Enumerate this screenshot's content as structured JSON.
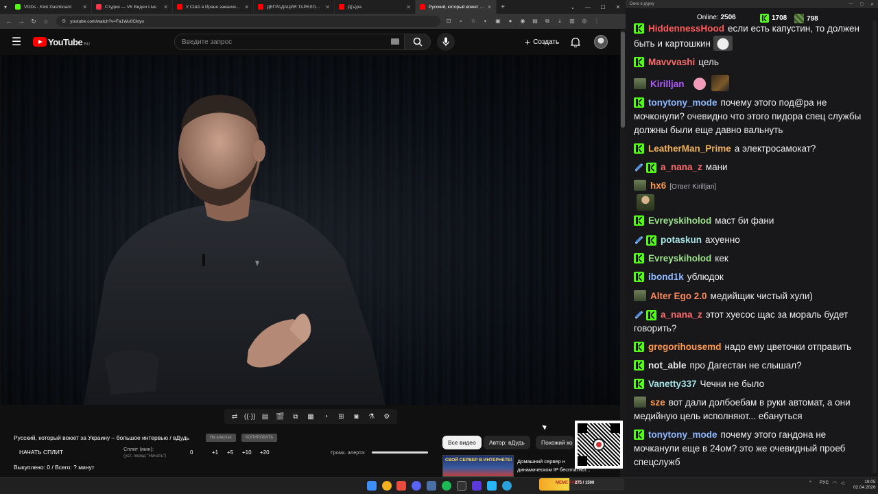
{
  "browser": {
    "tabs": [
      {
        "label": "VODs - Kick Dashboard",
        "color": "#53fc18",
        "active": false
      },
      {
        "label": "Студия — VK Видео Live",
        "color": "#ff3347",
        "active": false
      },
      {
        "label": "У США в Иране заканчиваются",
        "color": "#ff0000",
        "active": false
      },
      {
        "label": "ДЕГРАДАЦИЯ ТАРЕЛОЧНИЦ",
        "color": "#ff0000",
        "active": false
      },
      {
        "label": "Д(ъ)ра",
        "color": "#ff0000",
        "active": false
      },
      {
        "label": "Русский, который воюет за Ук",
        "color": "#ff0000",
        "active": true
      }
    ],
    "url": "youtube.com/watch?v=Fa1Wu0Cktyo"
  },
  "youtube": {
    "logo_text": "YouTube",
    "logo_region": "RU",
    "search_placeholder": "Введите запрос",
    "create_label": "Создать"
  },
  "video_panel": {
    "title": "Русский, который воюет за Украину – большое интервью / вДудь",
    "pill_1": "На алертах",
    "pill_2": "КОПИРОВАТЬ",
    "split_button": "НАЧАТЬ СПЛИТ",
    "split_label": "Сплит (мин):",
    "split_sub": "(уст. перед \"Начать\")",
    "split_values": [
      "0",
      "+1",
      "+5",
      "+10",
      "+20"
    ],
    "alert_volume_label": "Громк. алерта:",
    "alert_volume_level": 1.0,
    "bought": "Выкуплено: 0 / Всего: ? минут"
  },
  "chips": [
    {
      "label": "Все видео",
      "active": true
    },
    {
      "label": "Автор: вДудь",
      "active": false
    },
    {
      "label": "Похожий ко",
      "active": false
    }
  ],
  "ad": {
    "thumb_text": "СВОЙ СЕРВЕР В ИНТЕРНЕТЕ!",
    "line1": "Домашний сервер н",
    "line2": "динамическом IP бесплатно!..."
  },
  "chat": {
    "window_title": "Окно в дурку",
    "online_label": "Online:",
    "online_value": "2506",
    "stat_kick": "1708",
    "stat_sub": "798",
    "messages": [
      {
        "user": "HiddennessHood",
        "color": "#ff5a5a",
        "badges": [
          "k"
        ],
        "text": "если есть капустин, то должен быть и картошкин",
        "emote": "cat"
      },
      {
        "user": "Mavvvashi",
        "color": "#ff6b6b",
        "badges": [
          "k"
        ],
        "text": "цель",
        "emote": ""
      },
      {
        "user": "Kirilljan",
        "color": "#b05cff",
        "badges": [
          "sub"
        ],
        "text": "",
        "emote": "pig guy"
      },
      {
        "user": "tonytony_mode",
        "color": "#8fb8ff",
        "badges": [
          "k"
        ],
        "text": "почему этого под@ра не мочконули? очевидно что этого пидора спец службы должны были еще давно вальнуть",
        "emote": ""
      },
      {
        "user": "LeatherMan_Prime",
        "color": "#f0b35a",
        "badges": [
          "k"
        ],
        "text": "а электросамокат?",
        "emote": ""
      },
      {
        "user": "a_nana_z",
        "color": "#ff6b6b",
        "badges": [
          "sword",
          "k"
        ],
        "text": "мани",
        "emote": ""
      },
      {
        "user": "hx6",
        "color": "#ff9a4d",
        "badges": [
          "sub"
        ],
        "reply": "[Ответ Kirilljan]",
        "text": "",
        "emote": "soldier"
      },
      {
        "user": "Evreyskiholod",
        "color": "#9de38c",
        "badges": [
          "k"
        ],
        "text": "маст би фани",
        "emote": ""
      },
      {
        "user": "potaskun",
        "color": "#a6e3e3",
        "badges": [
          "sword",
          "k"
        ],
        "text": "ахуенно",
        "emote": ""
      },
      {
        "user": "Evreyskiholod",
        "color": "#9de38c",
        "badges": [
          "k"
        ],
        "text": "кек",
        "emote": ""
      },
      {
        "user": "ibond1k",
        "color": "#8fb8ff",
        "badges": [
          "k"
        ],
        "text": "ублюдок",
        "emote": ""
      },
      {
        "user": "Alter Ego 2.0",
        "color": "#ff8a5a",
        "badges": [
          "sub"
        ],
        "text": "медийщик чистый хули)",
        "emote": ""
      },
      {
        "user": "a_nana_z",
        "color": "#ff6b6b",
        "badges": [
          "sword",
          "k"
        ],
        "text": "этот хуесос щас за мораль будет говорить?",
        "emote": ""
      },
      {
        "user": "gregorihousemd",
        "color": "#ff9a4d",
        "badges": [
          "k"
        ],
        "text": "надо ему цветочки отправить",
        "emote": ""
      },
      {
        "user": "not_able",
        "color": "#e8e8e8",
        "badges": [
          "k"
        ],
        "text": "про Дагестан не слышал?",
        "emote": ""
      },
      {
        "user": "Vanetty337",
        "color": "#a6e3e3",
        "badges": [
          "k"
        ],
        "text": "Чечни не было",
        "emote": ""
      },
      {
        "user": "sze",
        "color": "#ff9a4d",
        "badges": [
          "sub"
        ],
        "text": "вот дали долбоебам в руки автомат, а они медийную цель исполняют... ебануться",
        "emote": ""
      },
      {
        "user": "tonytony_mode",
        "color": "#8fb8ff",
        "badges": [
          "k"
        ],
        "text": "почему этого гандона не мочканули еще в 24ом? это же очевидный проеб спецслужб",
        "emote": ""
      }
    ]
  },
  "taskbar": {
    "lang": "РУС",
    "time": "19:05",
    "date": "02.04.2026",
    "widget_text": "275 / 1500",
    "widget_brand": "MEME PARTY"
  }
}
